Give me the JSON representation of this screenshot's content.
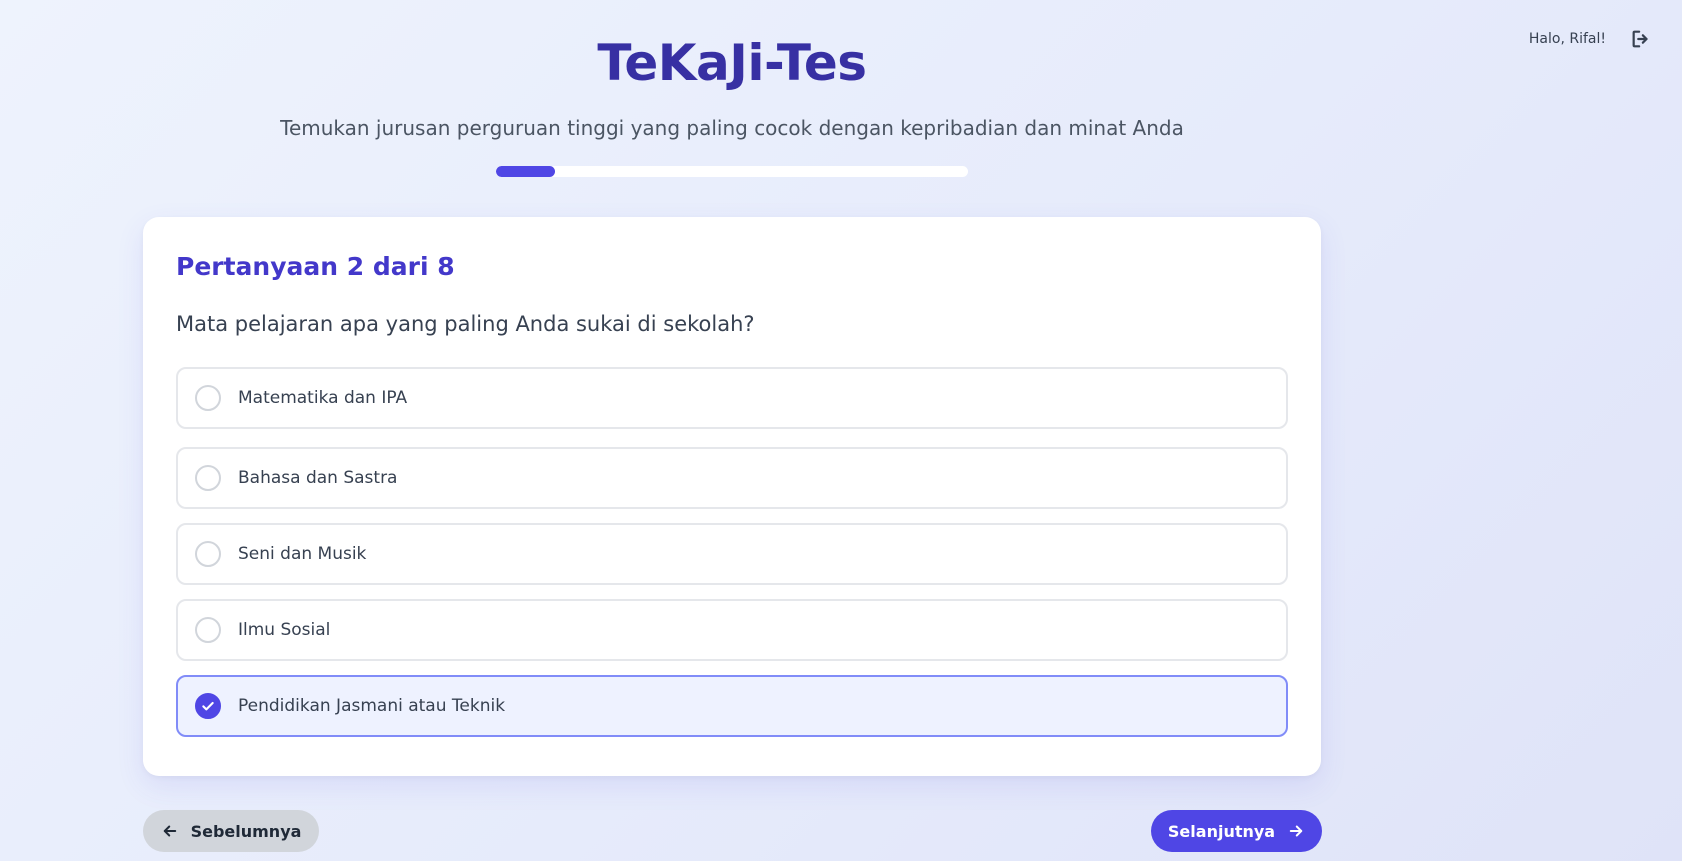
{
  "user": {
    "greeting": "Halo, Rifal!"
  },
  "header": {
    "title": "TeKaJi-Tes",
    "subtitle": "Temukan jurusan perguruan tinggi yang paling cocok dengan kepribadian dan minat Anda",
    "progress_fraction": 0.125
  },
  "question": {
    "counter": "Pertanyaan 2 dari 8",
    "text": "Mata pelajaran apa yang paling Anda sukai di sekolah?",
    "options": [
      {
        "label": "Matematika dan IPA",
        "selected": false
      },
      {
        "label": "Bahasa dan Sastra",
        "selected": false
      },
      {
        "label": "Seni dan Musik",
        "selected": false
      },
      {
        "label": "Ilmu Sosial",
        "selected": false
      },
      {
        "label": "Pendidikan Jasmani atau Teknik",
        "selected": true
      }
    ]
  },
  "nav": {
    "prev_label": "Sebelumnya",
    "next_label": "Selanjutnya"
  },
  "colors": {
    "accent": "#4f46e5",
    "title": "#3730a3",
    "selected_bg": "#eef2ff",
    "selected_border": "#818cf8"
  },
  "icons": {
    "logout": "logout-icon",
    "prev": "arrow-left-icon",
    "next": "arrow-right-icon",
    "check": "check-icon"
  }
}
